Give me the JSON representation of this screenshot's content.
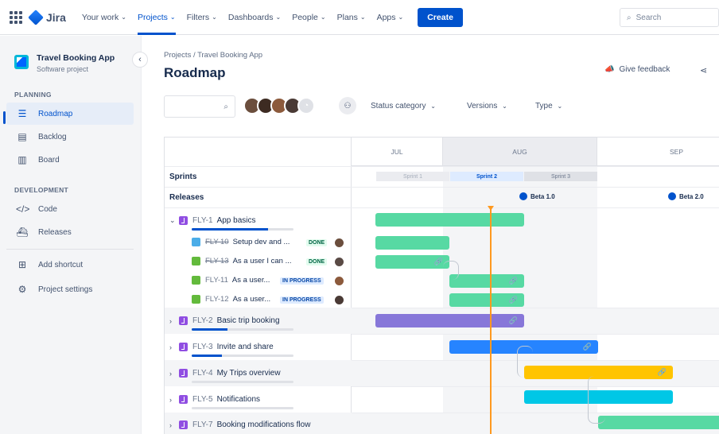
{
  "nav": {
    "logo": "Jira",
    "items": [
      {
        "label": "Your work",
        "active": false
      },
      {
        "label": "Projects",
        "active": true
      },
      {
        "label": "Filters",
        "active": false
      },
      {
        "label": "Dashboards",
        "active": false
      },
      {
        "label": "People",
        "active": false
      },
      {
        "label": "Plans",
        "active": false
      },
      {
        "label": "Apps",
        "active": false
      }
    ],
    "create_label": "Create",
    "search_placeholder": "Search"
  },
  "sidebar": {
    "project_name": "Travel Booking App",
    "project_type": "Software project",
    "planning_title": "PLANNING",
    "planning_items": [
      {
        "label": "Roadmap",
        "icon": "roadmap-icon"
      },
      {
        "label": "Backlog",
        "icon": "backlog-icon"
      },
      {
        "label": "Board",
        "icon": "board-icon"
      }
    ],
    "development_title": "DEVELOPMENT",
    "development_items": [
      {
        "label": "Code",
        "icon": "code-icon"
      },
      {
        "label": "Releases",
        "icon": "releases-icon"
      }
    ],
    "extra_items": [
      {
        "label": "Add shortcut",
        "icon": "add-shortcut-icon"
      },
      {
        "label": "Project settings",
        "icon": "settings-icon"
      }
    ]
  },
  "header": {
    "breadcrumb": "Projects  /  Travel Booking App",
    "title": "Roadmap",
    "feedback_label": "Give feedback"
  },
  "toolbar": {
    "status_label": "Status category",
    "versions_label": "Versions",
    "type_label": "Type"
  },
  "timeline": {
    "months": [
      "JUL",
      "AUG",
      "SEP"
    ],
    "sprints_label": "Sprints",
    "releases_label": "Releases",
    "sprints": [
      {
        "label": "Sprint 1",
        "state": "past"
      },
      {
        "label": "Sprint 2",
        "state": "current"
      },
      {
        "label": "Sprint 3",
        "state": "next"
      }
    ],
    "releases": [
      "Beta 1.0",
      "Beta 2.0"
    ],
    "epics": [
      {
        "key": "FLY-1",
        "title": "App basics",
        "expanded": true,
        "progress": 0.75,
        "color": "#57d9a3"
      },
      {
        "key": "FLY-2",
        "title": "Basic trip booking",
        "expanded": false,
        "progress": 0.35,
        "color": "#8777d9"
      },
      {
        "key": "FLY-3",
        "title": "Invite and share",
        "expanded": false,
        "progress": 0.3,
        "color": "#2684ff"
      },
      {
        "key": "FLY-4",
        "title": "My Trips overview",
        "expanded": false,
        "progress": 0.0,
        "color": "#ffc400"
      },
      {
        "key": "FLY-5",
        "title": "Notifications",
        "expanded": false,
        "progress": 0.0,
        "color": "#00c7e6"
      },
      {
        "key": "FLY-7",
        "title": "Booking modifications flow",
        "expanded": false,
        "progress": 0.0,
        "color": "#57d9a3"
      }
    ],
    "issues": [
      {
        "key": "FLY-10",
        "title": "Setup dev and ...",
        "status": "DONE",
        "type": "task"
      },
      {
        "key": "FLY-13",
        "title": "As a user I can ...",
        "status": "DONE",
        "type": "story"
      },
      {
        "key": "FLY-11",
        "title": "As a user...",
        "status": "IN PROGRESS",
        "type": "story"
      },
      {
        "key": "FLY-12",
        "title": "As a user...",
        "status": "IN PROGRESS",
        "type": "story"
      }
    ]
  },
  "colors": {
    "brand": "#0052cc",
    "today_marker": "#ff991f",
    "done": "#006644",
    "in_progress": "#0747a6"
  }
}
